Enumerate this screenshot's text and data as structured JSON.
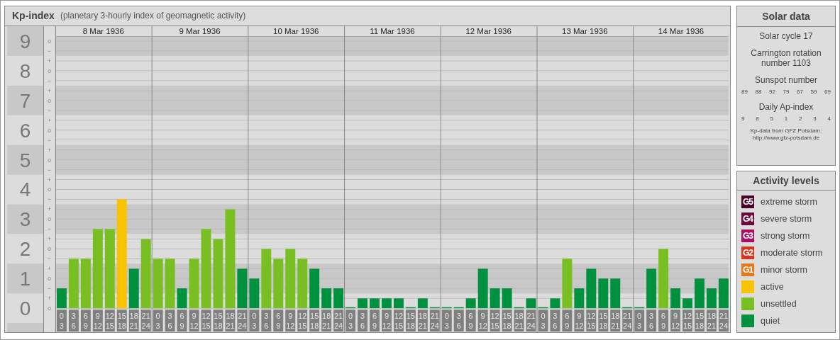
{
  "main": {
    "title": "Kp-index",
    "subtitle": "(planetary 3-hourly index of geomagnetic activity)",
    "days": [
      {
        "date": "8 Mar 1936",
        "slots": [
          {
            "from": "0",
            "to": "3"
          },
          {
            "from": "3",
            "to": "6"
          },
          {
            "from": "6",
            "to": "9"
          },
          {
            "from": "9",
            "to": "12"
          },
          {
            "from": "12",
            "to": "15"
          },
          {
            "from": "15",
            "to": "18"
          },
          {
            "from": "18",
            "to": "21"
          },
          {
            "from": "21",
            "to": "24"
          }
        ]
      },
      {
        "date": "9 Mar 1936",
        "slots": [
          {
            "from": "0",
            "to": "3"
          },
          {
            "from": "3",
            "to": "6"
          },
          {
            "from": "6",
            "to": "9"
          },
          {
            "from": "9",
            "to": "12"
          },
          {
            "from": "12",
            "to": "15"
          },
          {
            "from": "15",
            "to": "18"
          },
          {
            "from": "18",
            "to": "21"
          },
          {
            "from": "21",
            "to": "24"
          }
        ]
      },
      {
        "date": "10 Mar 1936",
        "slots": [
          {
            "from": "0",
            "to": "3"
          },
          {
            "from": "3",
            "to": "6"
          },
          {
            "from": "6",
            "to": "9"
          },
          {
            "from": "9",
            "to": "12"
          },
          {
            "from": "12",
            "to": "15"
          },
          {
            "from": "15",
            "to": "18"
          },
          {
            "from": "18",
            "to": "21"
          },
          {
            "from": "21",
            "to": "24"
          }
        ]
      },
      {
        "date": "11 Mar 1936",
        "slots": [
          {
            "from": "0",
            "to": "3"
          },
          {
            "from": "3",
            "to": "6"
          },
          {
            "from": "6",
            "to": "9"
          },
          {
            "from": "9",
            "to": "12"
          },
          {
            "from": "12",
            "to": "15"
          },
          {
            "from": "15",
            "to": "18"
          },
          {
            "from": "18",
            "to": "21"
          },
          {
            "from": "21",
            "to": "24"
          }
        ]
      },
      {
        "date": "12 Mar 1936",
        "slots": [
          {
            "from": "0",
            "to": "3"
          },
          {
            "from": "3",
            "to": "6"
          },
          {
            "from": "6",
            "to": "9"
          },
          {
            "from": "9",
            "to": "12"
          },
          {
            "from": "12",
            "to": "15"
          },
          {
            "from": "15",
            "to": "18"
          },
          {
            "from": "18",
            "to": "21"
          },
          {
            "from": "21",
            "to": "24"
          }
        ]
      },
      {
        "date": "13 Mar 1936",
        "slots": [
          {
            "from": "0",
            "to": "3"
          },
          {
            "from": "3",
            "to": "6"
          },
          {
            "from": "6",
            "to": "9"
          },
          {
            "from": "9",
            "to": "12"
          },
          {
            "from": "12",
            "to": "15"
          },
          {
            "from": "15",
            "to": "18"
          },
          {
            "from": "18",
            "to": "21"
          },
          {
            "from": "21",
            "to": "24"
          }
        ]
      },
      {
        "date": "14 Mar 1936",
        "slots": [
          {
            "from": "0",
            "to": "3"
          },
          {
            "from": "3",
            "to": "6"
          },
          {
            "from": "6",
            "to": "9"
          },
          {
            "from": "9",
            "to": "12"
          },
          {
            "from": "12",
            "to": "15"
          },
          {
            "from": "15",
            "to": "18"
          },
          {
            "from": "18",
            "to": "21"
          },
          {
            "from": "21",
            "to": "24"
          }
        ]
      }
    ],
    "kp_thirds": [
      "o",
      "−",
      "+",
      "o",
      "−",
      "+",
      "o",
      "−",
      "+",
      "o",
      "−",
      "+",
      "o",
      "−",
      "+",
      "o",
      "−",
      "+",
      "o",
      "−",
      "+",
      "o",
      "−",
      "+",
      "o",
      "−",
      "+",
      "o"
    ],
    "chart_data": {
      "type": "bar",
      "ylim": [
        0,
        9
      ],
      "grid": true,
      "yticks": [
        {
          "value": 0,
          "label": "0"
        },
        {
          "value": 1,
          "label": "1"
        },
        {
          "value": 2,
          "label": "2"
        },
        {
          "value": 3,
          "label": "3"
        },
        {
          "value": 4,
          "label": "4"
        },
        {
          "value": 5,
          "label": "5"
        },
        {
          "value": 6,
          "label": "6"
        },
        {
          "value": 7,
          "label": "7"
        },
        {
          "value": 8,
          "label": "8"
        },
        {
          "value": 9,
          "label": "9"
        }
      ],
      "series": [
        {
          "color": "#00913f",
          "values": [
            0.67,
            null,
            null,
            null,
            null,
            null,
            1.33,
            null,
            null,
            null,
            0.67,
            null,
            null,
            null,
            null,
            1.33,
            1,
            null,
            null,
            null,
            null,
            1.33,
            0.67,
            0.67,
            0,
            0.33,
            0.33,
            0.33,
            0.33,
            0,
            0.33,
            0,
            0,
            0,
            0.33,
            1.33,
            0.67,
            0.67,
            0,
            0.33,
            0,
            0.33,
            null,
            0.67,
            1.33,
            1,
            1,
            0,
            0,
            1.33,
            null,
            0.67,
            0.33,
            1,
            0.67,
            1
          ]
        },
        {
          "color": "#7abf22",
          "values": [
            null,
            1.67,
            1.67,
            2.67,
            2.67,
            null,
            null,
            2.33,
            1.67,
            1.67,
            null,
            1.67,
            2.67,
            2.33,
            3.33,
            null,
            null,
            2,
            1.67,
            2,
            1.67,
            null,
            null,
            null,
            null,
            null,
            null,
            null,
            null,
            null,
            null,
            null,
            null,
            null,
            null,
            null,
            null,
            null,
            null,
            null,
            null,
            null,
            1.67,
            null,
            null,
            null,
            null,
            null,
            null,
            null,
            2,
            null,
            null,
            null,
            null,
            null
          ]
        },
        {
          "color": "#f8c300",
          "values": [
            null,
            null,
            null,
            null,
            null,
            3.67,
            null,
            null,
            null,
            null,
            null,
            null,
            null,
            null,
            null,
            null,
            null,
            null,
            null,
            null,
            null,
            null,
            null,
            null,
            null,
            null,
            null,
            null,
            null,
            null,
            null,
            null,
            null,
            null,
            null,
            null,
            null,
            null,
            null,
            null,
            null,
            null,
            null,
            null,
            null,
            null,
            null,
            null,
            null,
            null,
            null,
            null,
            null,
            null,
            null,
            null
          ]
        }
      ]
    }
  },
  "solar": {
    "title": "Solar data",
    "cycle": "Solar cycle 17",
    "carrington": "Carrington rotation number 1103",
    "sunspot_title": "Sunspot number",
    "sunspot": [
      "89",
      "88",
      "92",
      "79",
      "67",
      "59",
      "69"
    ],
    "ap_title": "Daily Ap-index",
    "ap": [
      "9",
      "8",
      "5",
      "1",
      "2",
      "3",
      "4"
    ],
    "source": [
      "Kp-data from GFZ Potsdam:",
      "http://www.gfz-potsdam.de"
    ]
  },
  "legend": {
    "title": "Activity levels",
    "items": [
      {
        "badge": "G5",
        "label": "extreme storm",
        "color": "#4a0526"
      },
      {
        "badge": "G4",
        "label": "severe storm",
        "color": "#6b0a3c"
      },
      {
        "badge": "G3",
        "label": "strong storm",
        "color": "#a80f60"
      },
      {
        "badge": "G2",
        "label": "moderate storm",
        "color": "#d8341e"
      },
      {
        "badge": "G1",
        "label": "minor storm",
        "color": "#e5781a"
      },
      {
        "label": "active",
        "color": "#f8c300"
      },
      {
        "label": "unsettled",
        "color": "#7abf22"
      },
      {
        "label": "quiet",
        "color": "#00913f"
      }
    ]
  }
}
